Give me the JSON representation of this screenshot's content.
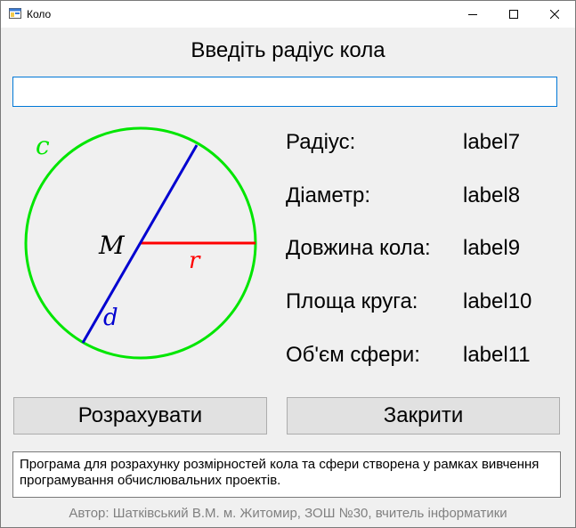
{
  "window": {
    "title": "Коло",
    "minimize_icon": "minimize-icon",
    "maximize_icon": "maximize-icon",
    "close_icon": "close-icon"
  },
  "heading": "Введіть радіус кола",
  "input": {
    "value": "",
    "placeholder": ""
  },
  "diagram": {
    "circle_label": "c",
    "center_label": "M",
    "radius_label": "r",
    "diameter_label": "d",
    "colors": {
      "circle": "#00e600",
      "radius": "#ff0000",
      "diameter": "#0000d0"
    }
  },
  "results": [
    {
      "name": "Радіус:",
      "value": "label7"
    },
    {
      "name": "Діаметр:",
      "value": "label8"
    },
    {
      "name": "Довжина кола:",
      "value": "label9"
    },
    {
      "name": "Площа круга:",
      "value": "label10"
    },
    {
      "name": "Об'єм сфери:",
      "value": "label11"
    }
  ],
  "buttons": {
    "calculate": "Розрахувати",
    "close": "Закрити"
  },
  "info_text": "Програма для розрахунку розмірностей кола та сфери створена у рамках вивчення програмування обчислювальних проектів.",
  "author": "Автор: Шатківський В.М. м. Житомир, ЗОШ №30, вчитель інформатики"
}
